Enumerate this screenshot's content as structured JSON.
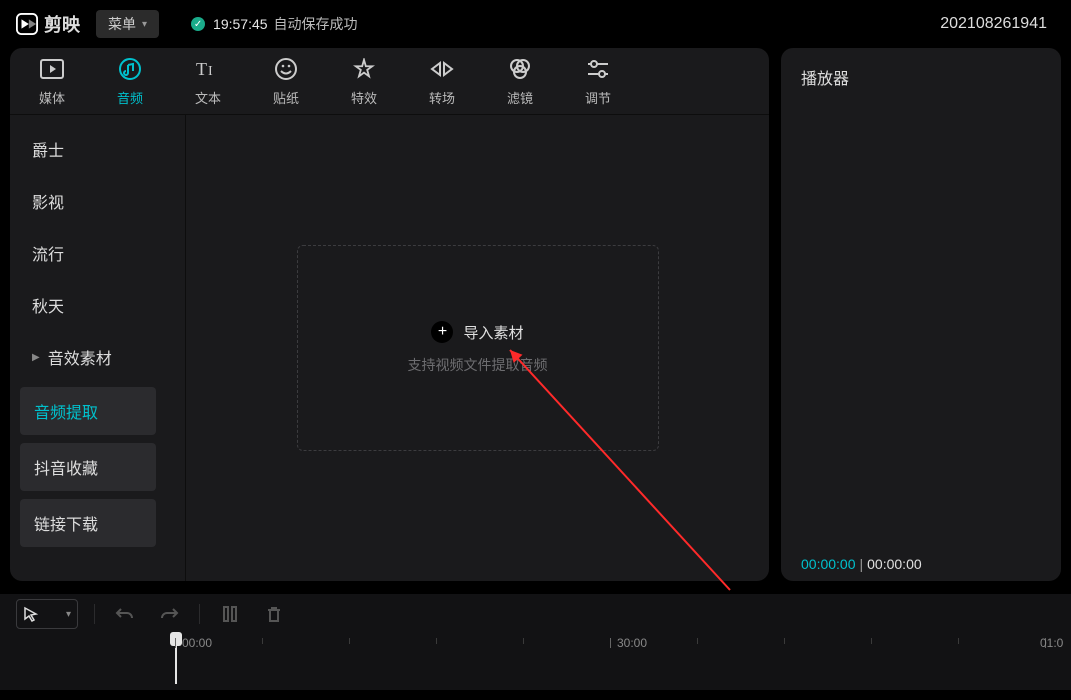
{
  "app": {
    "name": "剪映"
  },
  "menu": {
    "label": "菜单"
  },
  "save": {
    "time": "19:57:45",
    "text": "自动保存成功"
  },
  "project": {
    "id": "202108261941"
  },
  "tabs": {
    "media": "媒体",
    "audio": "音频",
    "text": "文本",
    "sticker": "贴纸",
    "effect": "特效",
    "trans": "转场",
    "filter": "滤镜",
    "adjust": "调节"
  },
  "sidebar": {
    "cats": {
      "jazz": "爵士",
      "film": "影视",
      "pop": "流行",
      "autumn": "秋天"
    },
    "items": {
      "sfx": "音效素材",
      "extract": "音频提取",
      "douyin": "抖音收藏",
      "link": "链接下载"
    }
  },
  "import": {
    "label": "导入素材",
    "hint": "支持视频文件提取音频"
  },
  "player": {
    "title": "播放器",
    "current": "00:00:00",
    "total": "00:00:00"
  },
  "ruler": {
    "t0": "00:00",
    "t1": "30:00",
    "t2": "01:0"
  }
}
